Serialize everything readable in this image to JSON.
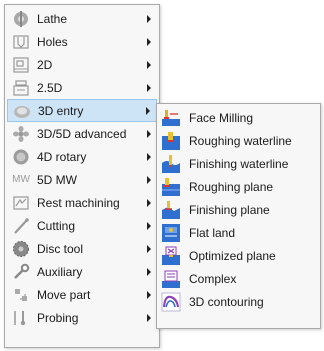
{
  "menu": {
    "items": [
      {
        "label": "Lathe",
        "icon": "lathe-icon"
      },
      {
        "label": "Holes",
        "icon": "holes-icon"
      },
      {
        "label": "2D",
        "icon": "2d-icon"
      },
      {
        "label": "2.5D",
        "icon": "2-5d-icon"
      },
      {
        "label": "3D entry",
        "icon": "3d-entry-icon"
      },
      {
        "label": "3D/5D advanced",
        "icon": "3d-5d-advanced-icon"
      },
      {
        "label": "4D rotary",
        "icon": "4d-rotary-icon"
      },
      {
        "label": "5D MW",
        "icon": "5d-mw-icon",
        "icon_text": "MW"
      },
      {
        "label": "Rest machining",
        "icon": "rest-machining-icon"
      },
      {
        "label": "Cutting",
        "icon": "cutting-icon"
      },
      {
        "label": "Disc tool",
        "icon": "disc-tool-icon"
      },
      {
        "label": "Auxiliary",
        "icon": "auxiliary-icon"
      },
      {
        "label": "Move part",
        "icon": "move-part-icon"
      },
      {
        "label": "Probing",
        "icon": "probing-icon"
      }
    ],
    "active_item": "3D entry"
  },
  "submenu": {
    "items": [
      {
        "label": "Face Milling",
        "icon": "face-milling-icon"
      },
      {
        "label": "Roughing waterline",
        "icon": "roughing-waterline-icon"
      },
      {
        "label": "Finishing waterline",
        "icon": "finishing-waterline-icon"
      },
      {
        "label": "Roughing plane",
        "icon": "roughing-plane-icon"
      },
      {
        "label": "Finishing plane",
        "icon": "finishing-plane-icon"
      },
      {
        "label": "Flat land",
        "icon": "flat-land-icon"
      },
      {
        "label": "Optimized plane",
        "icon": "optimized-plane-icon"
      },
      {
        "label": "Complex",
        "icon": "complex-icon"
      },
      {
        "label": "3D contouring",
        "icon": "3d-contouring-icon"
      }
    ]
  },
  "colors": {
    "highlight": "#cde4f7",
    "highlight_border": "#99c6ec",
    "menu_bg": "#f7f7f7",
    "border": "#a9a9a9"
  }
}
